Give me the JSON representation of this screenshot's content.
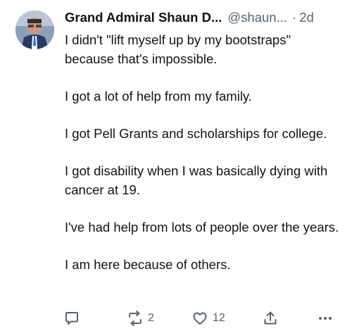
{
  "tweet": {
    "author_name": "Grand Admiral Shaun D...",
    "author_handle": "@shaun...",
    "separator": "·",
    "timestamp": "2d",
    "paragraphs": [
      "I didn't \"lift myself up by my bootstraps\" because that's impossible.",
      "I got a lot of help from my family.",
      "I got Pell Grants and scholarships for college.",
      "I got disability when I was basically dying with cancer at 19.",
      "I've had help from lots of people over the years.",
      "I am here because of others."
    ]
  },
  "actions": {
    "reply_icon": "comment-icon",
    "retweet_icon": "retweet-icon",
    "retweet_count": "2",
    "like_icon": "heart-icon",
    "like_count": "12",
    "share_icon": "share-icon",
    "more_icon": "more-horizontal-icon"
  },
  "colors": {
    "text": "#0f1419",
    "secondary": "#536471",
    "background": "#ffffff"
  }
}
